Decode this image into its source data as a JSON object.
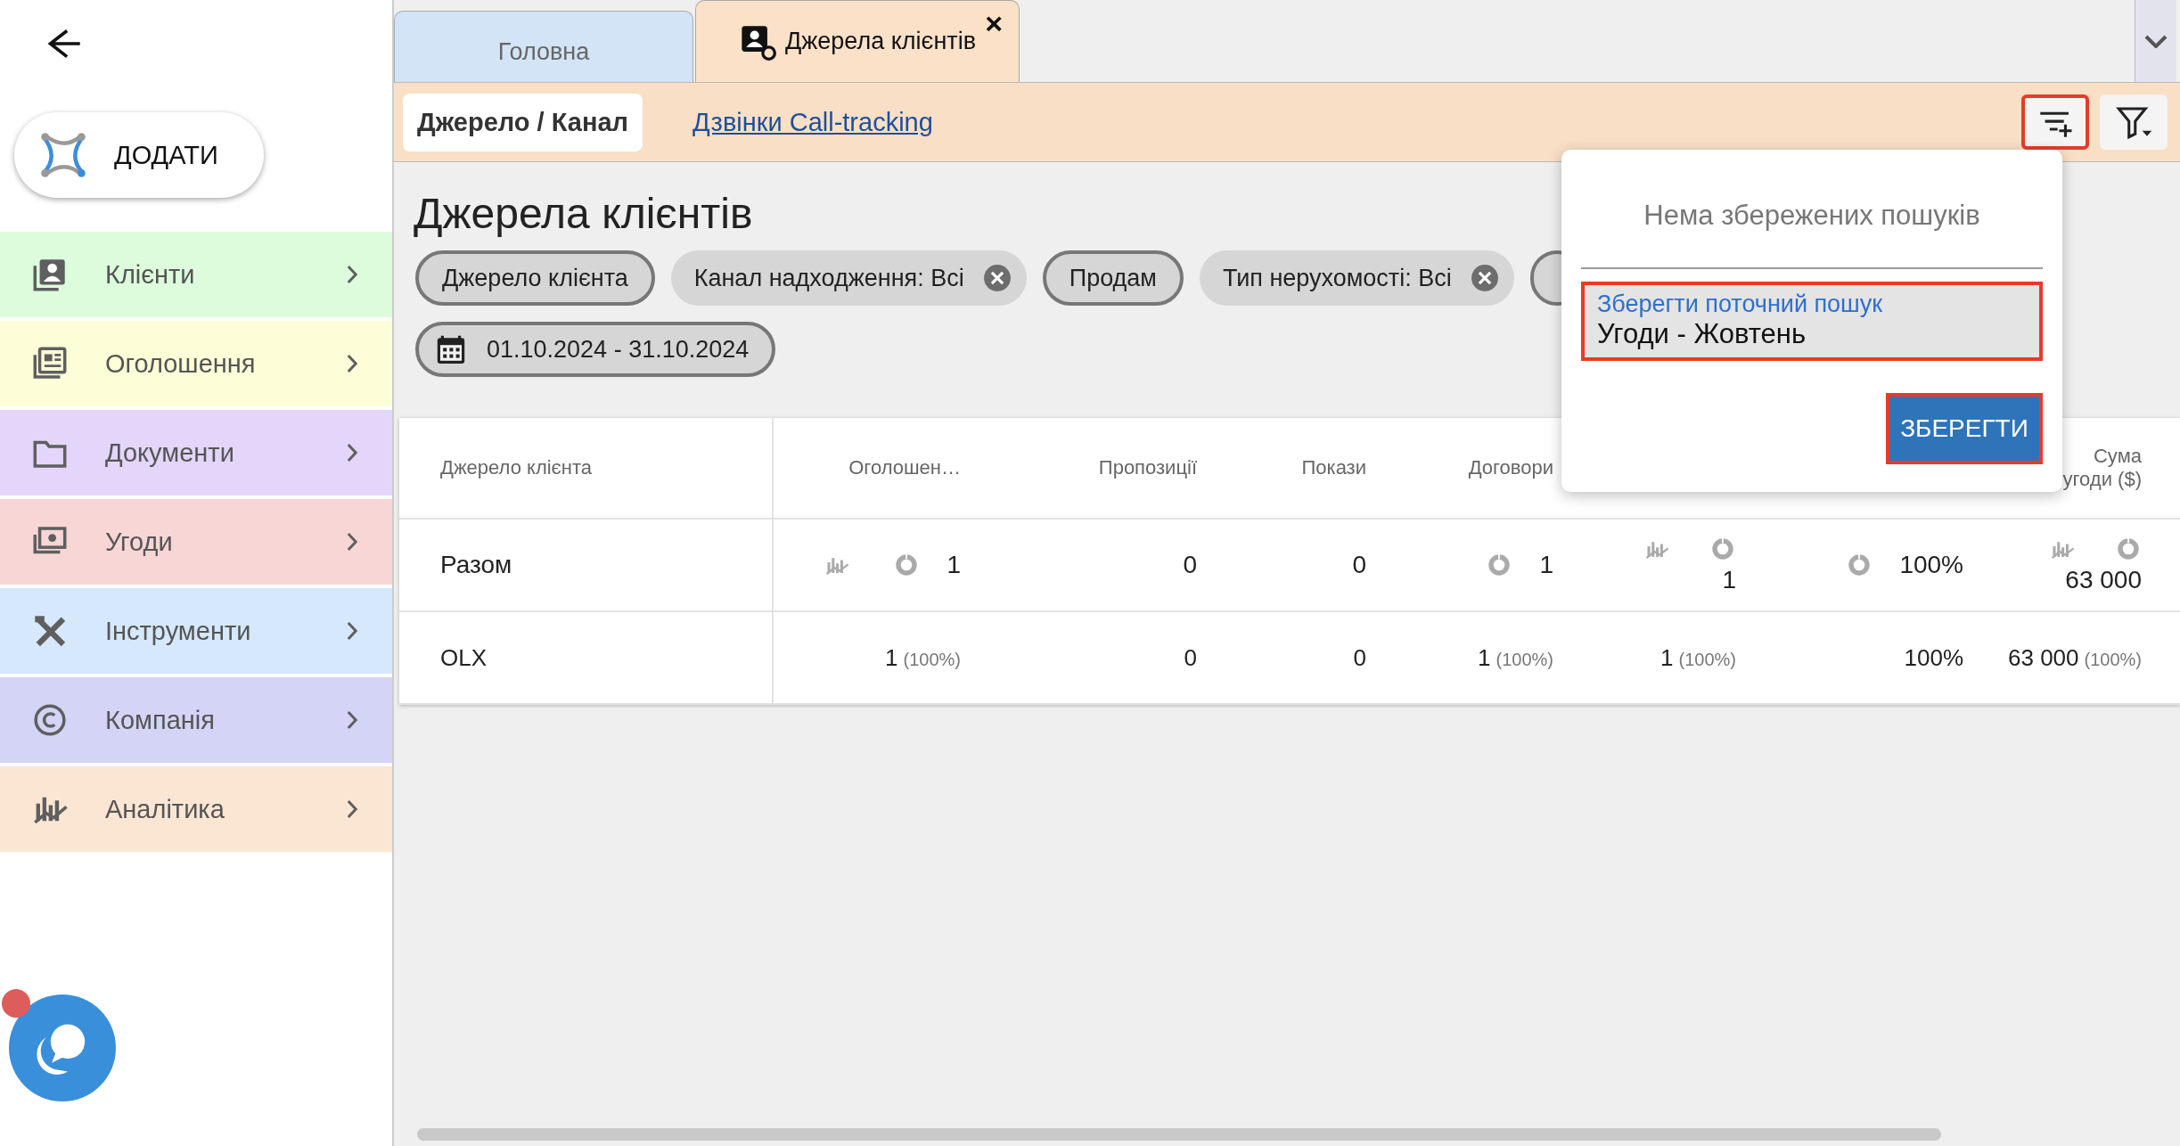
{
  "sidebar": {
    "add_button": {
      "label": "ДОДАТИ"
    },
    "items": [
      {
        "label": "Клієнти",
        "color": "#dcfcdc"
      },
      {
        "label": "Оголошення",
        "color": "#fdfdd8"
      },
      {
        "label": "Документи",
        "color": "#e4d6fa"
      },
      {
        "label": "Угоди",
        "color": "#f8d6d6"
      },
      {
        "label": "Інструменти",
        "color": "#d6e8fb"
      },
      {
        "label": "Компанія",
        "color": "#d3d4f6"
      },
      {
        "label": "Аналітика",
        "color": "#fbe6d3"
      }
    ],
    "chat": {
      "unread": true
    }
  },
  "tabs": [
    {
      "label": "Головна",
      "selected": false
    },
    {
      "label": "Джерела клієнтів",
      "selected": true,
      "close": "×"
    }
  ],
  "subtabs": [
    {
      "label": "Джерело / Канал",
      "selected": true
    },
    {
      "label": "Дзвінки Call-tracking",
      "selected": false
    }
  ],
  "toolbar": [
    {
      "highlighted": true
    },
    {
      "highlighted": false
    }
  ],
  "title": "Джерела клієнтів",
  "chips": [
    {
      "kind": "outlined",
      "label": "Джерело клієнта"
    },
    {
      "kind": "removable",
      "label": "Канал надходження: Всі"
    },
    {
      "kind": "outlined",
      "label": "Продам"
    },
    {
      "kind": "removable",
      "label": "Тип нерухомості: Всі"
    },
    {
      "kind": "outlined"
    },
    {
      "kind": "date",
      "label": "01.10.2024 - 31.10.2024"
    }
  ],
  "table": {
    "columns": [
      "Джерело клієнта",
      "Оголошен…",
      "Пропозиції",
      "Покази",
      "Договори",
      "",
      "",
      "Сума угоди ($)"
    ],
    "rows": [
      {
        "kind": "total",
        "cells": [
          {
            "kind": "label",
            "value": "Разом"
          },
          {
            "kind": "chart_donut",
            "value": "1"
          },
          {
            "kind": "plain",
            "value": "0"
          },
          {
            "kind": "plain",
            "value": "0"
          },
          {
            "kind": "donut",
            "value": "1"
          },
          {
            "kind": "chart_donut_stacked",
            "value": "1"
          },
          {
            "kind": "donut",
            "value": "100%"
          },
          {
            "kind": "chart_donut_stacked",
            "value": "63 000"
          }
        ]
      },
      {
        "kind": "normal",
        "cells": [
          {
            "kind": "label",
            "value": "OLX"
          },
          {
            "kind": "plain",
            "value": "1",
            "note": "(100%)"
          },
          {
            "kind": "plain",
            "value": "0"
          },
          {
            "kind": "plain",
            "value": "0"
          },
          {
            "kind": "plain",
            "value": "1",
            "note": "(100%)"
          },
          {
            "kind": "plain",
            "value": "1",
            "note": "(100%)"
          },
          {
            "kind": "plain",
            "value": "100%"
          },
          {
            "kind": "plain",
            "value": "63 000",
            "note": "(100%)"
          }
        ]
      }
    ]
  },
  "saved_searches": {
    "empty_text": "Нема збережених пошуків",
    "field": {
      "label": "Зберегти поточний пошук",
      "value": "Угоди - Жовтень",
      "highlighted": true
    },
    "save_button": {
      "label": "ЗБЕРЕГТИ",
      "highlighted": true
    }
  }
}
